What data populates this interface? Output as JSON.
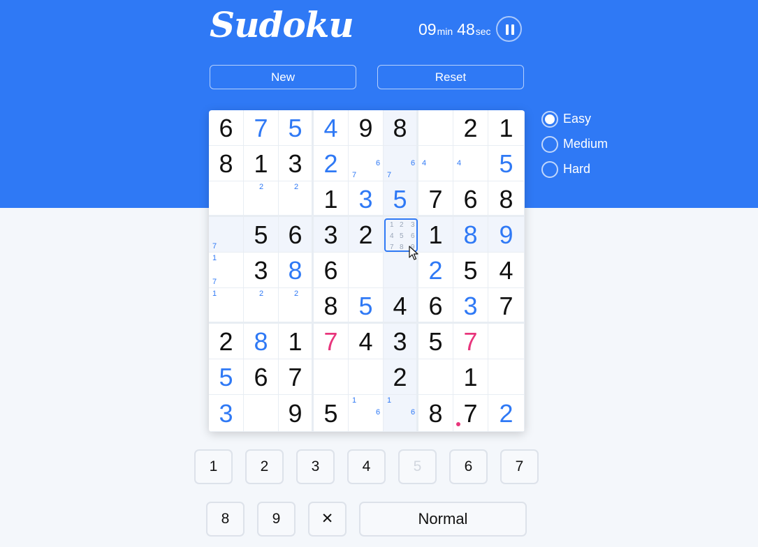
{
  "app": {
    "title": "Sudoku"
  },
  "timer": {
    "minutes": "09",
    "minutes_unit": "min",
    "seconds": "48",
    "seconds_unit": "sec"
  },
  "controls": {
    "new_label": "New",
    "reset_label": "Reset"
  },
  "difficulty": {
    "options": [
      {
        "label": "Easy",
        "checked": true
      },
      {
        "label": "Medium",
        "checked": false
      },
      {
        "label": "Hard",
        "checked": false
      }
    ]
  },
  "board": {
    "rows": [
      [
        {
          "v": "6",
          "t": "given"
        },
        {
          "v": "7",
          "t": "user"
        },
        {
          "v": "5",
          "t": "user"
        },
        {
          "v": "4",
          "t": "user"
        },
        {
          "v": "9",
          "t": "given"
        },
        {
          "v": "8",
          "t": "given"
        },
        {
          "v": "",
          "t": "empty"
        },
        {
          "v": "2",
          "t": "given"
        },
        {
          "v": "1",
          "t": "given"
        }
      ],
      [
        {
          "v": "8",
          "t": "given"
        },
        {
          "v": "1",
          "t": "given"
        },
        {
          "v": "3",
          "t": "given"
        },
        {
          "v": "2",
          "t": "user"
        },
        {
          "v": "",
          "t": "empty",
          "notes": [
            "6",
            "7"
          ]
        },
        {
          "v": "",
          "t": "empty",
          "notes": [
            "6",
            "7"
          ]
        },
        {
          "v": "",
          "t": "empty",
          "notes": [
            "4"
          ]
        },
        {
          "v": "",
          "t": "empty",
          "notes": [
            "4"
          ]
        },
        {
          "v": "5",
          "t": "user"
        }
      ],
      [
        {
          "v": "",
          "t": "empty"
        },
        {
          "v": "",
          "t": "empty",
          "notes": [
            "2"
          ]
        },
        {
          "v": "",
          "t": "empty",
          "notes": [
            "2"
          ]
        },
        {
          "v": "1",
          "t": "given"
        },
        {
          "v": "3",
          "t": "user"
        },
        {
          "v": "5",
          "t": "user"
        },
        {
          "v": "7",
          "t": "given"
        },
        {
          "v": "6",
          "t": "given"
        },
        {
          "v": "8",
          "t": "given"
        }
      ],
      [
        {
          "v": "",
          "t": "empty",
          "notes": [
            "7"
          ]
        },
        {
          "v": "5",
          "t": "given"
        },
        {
          "v": "6",
          "t": "given"
        },
        {
          "v": "3",
          "t": "given"
        },
        {
          "v": "2",
          "t": "given"
        },
        {
          "v": "",
          "t": "selected"
        },
        {
          "v": "1",
          "t": "given"
        },
        {
          "v": "8",
          "t": "user"
        },
        {
          "v": "9",
          "t": "user"
        }
      ],
      [
        {
          "v": "",
          "t": "empty",
          "notes": [
            "1",
            "7"
          ]
        },
        {
          "v": "3",
          "t": "given"
        },
        {
          "v": "8",
          "t": "user"
        },
        {
          "v": "6",
          "t": "given"
        },
        {
          "v": "",
          "t": "empty"
        },
        {
          "v": "",
          "t": "empty"
        },
        {
          "v": "2",
          "t": "user"
        },
        {
          "v": "5",
          "t": "given"
        },
        {
          "v": "4",
          "t": "given"
        }
      ],
      [
        {
          "v": "",
          "t": "empty",
          "notes": [
            "1"
          ]
        },
        {
          "v": "",
          "t": "empty",
          "notes": [
            "2"
          ]
        },
        {
          "v": "",
          "t": "empty",
          "notes": [
            "2"
          ]
        },
        {
          "v": "8",
          "t": "given"
        },
        {
          "v": "5",
          "t": "user"
        },
        {
          "v": "4",
          "t": "given"
        },
        {
          "v": "6",
          "t": "given"
        },
        {
          "v": "3",
          "t": "user"
        },
        {
          "v": "7",
          "t": "given"
        }
      ],
      [
        {
          "v": "2",
          "t": "given"
        },
        {
          "v": "8",
          "t": "user"
        },
        {
          "v": "1",
          "t": "given"
        },
        {
          "v": "7",
          "t": "error"
        },
        {
          "v": "4",
          "t": "given"
        },
        {
          "v": "3",
          "t": "given"
        },
        {
          "v": "5",
          "t": "given"
        },
        {
          "v": "7",
          "t": "error"
        },
        {
          "v": "",
          "t": "empty"
        }
      ],
      [
        {
          "v": "5",
          "t": "user"
        },
        {
          "v": "6",
          "t": "given"
        },
        {
          "v": "7",
          "t": "given"
        },
        {
          "v": "",
          "t": "empty"
        },
        {
          "v": "",
          "t": "empty"
        },
        {
          "v": "2",
          "t": "given"
        },
        {
          "v": "",
          "t": "empty"
        },
        {
          "v": "1",
          "t": "given"
        },
        {
          "v": "",
          "t": "empty"
        }
      ],
      [
        {
          "v": "3",
          "t": "user"
        },
        {
          "v": "",
          "t": "empty"
        },
        {
          "v": "9",
          "t": "given"
        },
        {
          "v": "5",
          "t": "given"
        },
        {
          "v": "",
          "t": "empty",
          "notes": [
            "1",
            "6"
          ]
        },
        {
          "v": "",
          "t": "empty",
          "notes": [
            "1",
            "6"
          ]
        },
        {
          "v": "8",
          "t": "given"
        },
        {
          "v": "7",
          "t": "given"
        },
        {
          "v": "2",
          "t": "user"
        }
      ]
    ],
    "selected_guides": [
      "1",
      "2",
      "3",
      "4",
      "5",
      "6",
      "7",
      "8",
      "9"
    ]
  },
  "keypad": {
    "row1": [
      {
        "label": "1",
        "disabled": false
      },
      {
        "label": "2",
        "disabled": false
      },
      {
        "label": "3",
        "disabled": false
      },
      {
        "label": "4",
        "disabled": false
      },
      {
        "label": "5",
        "disabled": true
      },
      {
        "label": "6",
        "disabled": false
      },
      {
        "label": "7",
        "disabled": false
      }
    ],
    "row2": [
      {
        "label": "8",
        "disabled": false
      },
      {
        "label": "9",
        "disabled": false
      }
    ],
    "erase_label": "✕",
    "mode_label": "Normal"
  },
  "colors": {
    "accent": "#2f79f5",
    "error": "#e8357c",
    "background": "#f4f7fb"
  }
}
